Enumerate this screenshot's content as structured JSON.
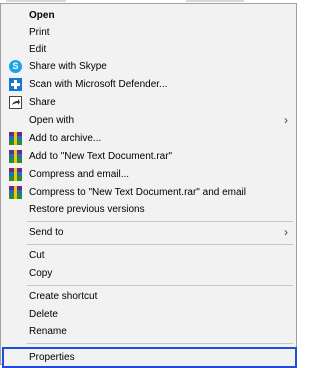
{
  "menu": {
    "items": [
      {
        "label": "Open",
        "bold": true,
        "icon": null,
        "submenu": false
      },
      {
        "label": "Print",
        "icon": null,
        "submenu": false
      },
      {
        "label": "Edit",
        "icon": null,
        "submenu": false
      },
      {
        "label": "Share with Skype",
        "icon": "skype-icon",
        "submenu": false
      },
      {
        "label": "Scan with Microsoft Defender...",
        "icon": "defender-icon",
        "submenu": false
      },
      {
        "label": "Share",
        "icon": "share-icon",
        "submenu": false
      },
      {
        "label": "Open with",
        "icon": null,
        "submenu": true
      },
      {
        "label": "Add to archive...",
        "icon": "winrar-icon",
        "submenu": false
      },
      {
        "label": "Add to \"New Text Document.rar\"",
        "icon": "winrar-icon",
        "submenu": false
      },
      {
        "label": "Compress and email...",
        "icon": "winrar-icon",
        "submenu": false
      },
      {
        "label": "Compress to \"New Text Document.rar\" and email",
        "icon": "winrar-icon",
        "submenu": false
      },
      {
        "label": "Restore previous versions",
        "icon": null,
        "submenu": false
      },
      {
        "label": "Send to",
        "icon": null,
        "submenu": true
      },
      {
        "label": "Cut",
        "icon": null,
        "submenu": false
      },
      {
        "label": "Copy",
        "icon": null,
        "submenu": false
      },
      {
        "label": "Create shortcut",
        "icon": null,
        "submenu": false
      },
      {
        "label": "Delete",
        "icon": null,
        "submenu": false
      },
      {
        "label": "Rename",
        "icon": null,
        "submenu": false
      }
    ],
    "properties_label": "Properties",
    "submenu_arrow": "›",
    "skype_glyph": "S",
    "highlight_color": "#1f4de0"
  }
}
